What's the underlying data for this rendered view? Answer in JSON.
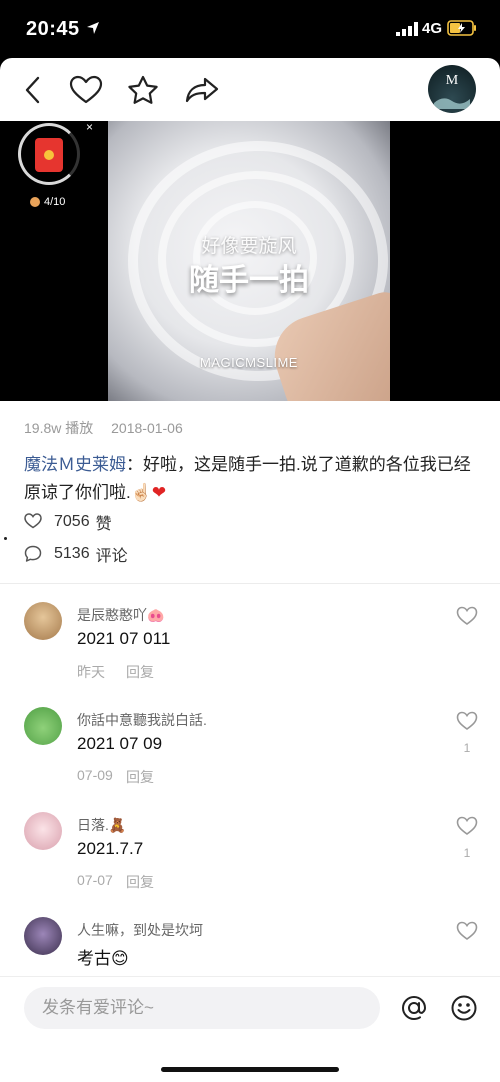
{
  "status_bar": {
    "time": "20:45",
    "network": "4G"
  },
  "nav": {
    "back_icon": "back-arrow-icon",
    "like_icon": "heart-outline-icon",
    "favorite_icon": "star-outline-icon",
    "share_icon": "share-arrow-icon",
    "avatar_mark": "M"
  },
  "video": {
    "caption_small": "好像要旋风",
    "caption_big": "随手一拍",
    "brand": "MAGICMSLIME"
  },
  "reward": {
    "progress": "4/10",
    "close": "×"
  },
  "post": {
    "plays": "19.8w 播放",
    "date": "2018-01-06",
    "author": "魔法Ｍ史莱姆",
    "separator": "：",
    "text": "好啦，这是随手一拍.说了道歉的各位我已经原谅了你们啦.",
    "emoji_hand": "☝🏻",
    "emoji_heart": "❤",
    "likes": "7056",
    "likes_label": "赞",
    "comments": "5136",
    "comments_label": "评论"
  },
  "comments": [
    {
      "name": "是辰憨憨吖🐽",
      "text": "2021 07 011",
      "time": "昨天",
      "reply": "回复",
      "likes": "",
      "avatar_color": "#c9a57a"
    },
    {
      "name": "你話中意聽我説白話.",
      "text": "2021 07 09",
      "time": "07-09",
      "reply": "回复",
      "likes": "1",
      "avatar_color": "#7cc46a"
    },
    {
      "name": "日落.🧸",
      "text": "2021.7.7",
      "time": "07-07",
      "reply": "回复",
      "likes": "1",
      "avatar_color": "#f2c6cf"
    },
    {
      "name": "人生嘛，到处是坎坷",
      "text": "考古😊",
      "time": "",
      "reply": "",
      "likes": "",
      "avatar_color": "#6b5a86"
    }
  ],
  "input": {
    "placeholder": "发条有爱评论~"
  },
  "bottom": {
    "at_icon": "at-icon",
    "emoji_icon": "smiley-icon"
  },
  "colors": {
    "accent_author": "#3b5b93",
    "heart": "#e02424",
    "red_packet": "#e6352f"
  }
}
